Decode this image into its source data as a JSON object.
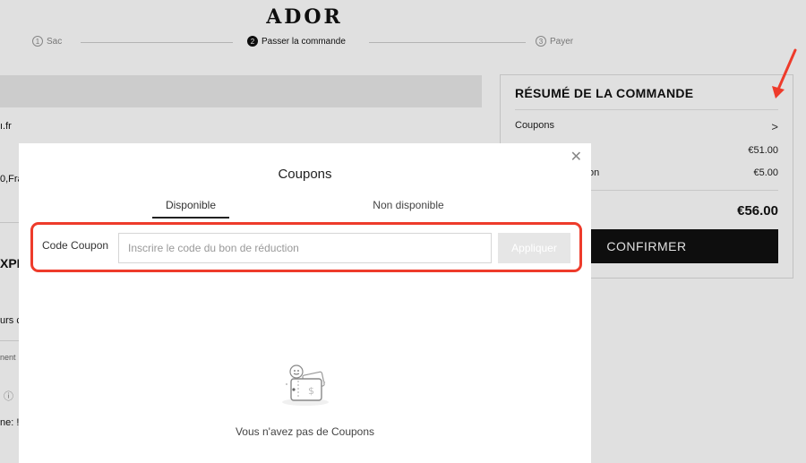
{
  "brand": {
    "logo": "ADOR"
  },
  "steps": [
    {
      "num": "1",
      "label": "Sac"
    },
    {
      "num": "2",
      "label": "Passer la commande"
    },
    {
      "num": "3",
      "label": "Payer"
    }
  ],
  "left_partial": {
    "email_fragment": "ı.fr",
    "address_fragment": "0,Fra",
    "heading_fragment": "XPÉ",
    "line1_fragment": "urs c",
    "line2_fragment": "nent",
    "info_icon": "info-icon",
    "line3_fragment": "ne: !"
  },
  "summary": {
    "title": "RÉSUMÉ DE LA COMMANDE",
    "coupons_label": "Coupons",
    "chevron": ">",
    "row1_value": "€51.00",
    "row2_label_fragment": "on",
    "row2_value": "€5.00",
    "total": "€56.00",
    "confirm_label": "CONFIRMER"
  },
  "modal": {
    "title": "Coupons",
    "close": "✕",
    "tabs": [
      {
        "label": "Disponible",
        "active": true
      },
      {
        "label": "Non disponible",
        "active": false
      }
    ],
    "coupon_label": "Code Coupon",
    "coupon_placeholder": "Inscrire le code du bon de réduction",
    "apply_label": "Appliquer",
    "empty_icon": "empty-wallet-icon",
    "empty_text": "Vous n'avez pas de Coupons"
  },
  "colors": {
    "highlight": "#ee3b2b",
    "dark": "#111111"
  }
}
